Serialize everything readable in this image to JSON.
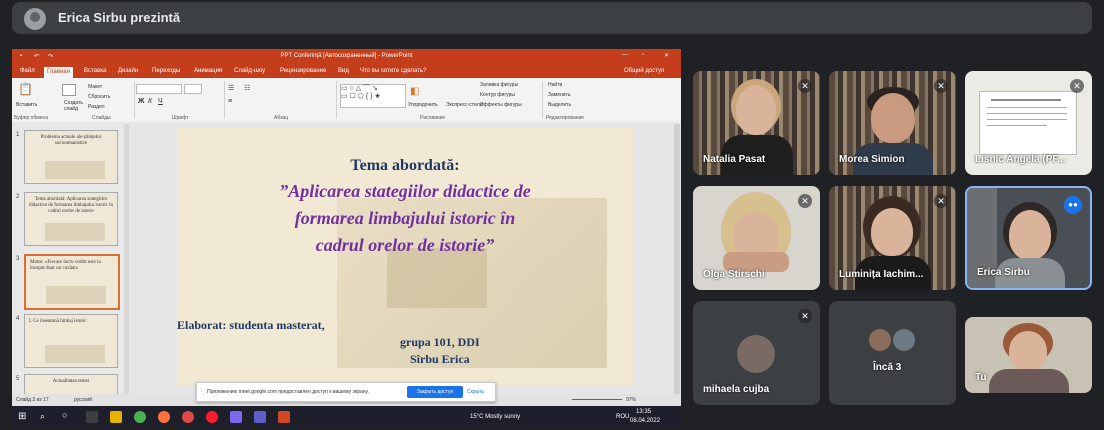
{
  "presenter": {
    "text": "Erica Sirbu prezintă"
  },
  "ppt": {
    "title": "PPT Conferinţă [Автосохраненный] - PowerPoint",
    "tabs": [
      "Файл",
      "Главная",
      "Вставка",
      "Дизайн",
      "Переходы",
      "Анимация",
      "Слайд-шоу",
      "Рецензирование",
      "Вид",
      "Что вы хотите сделать?"
    ],
    "share": "Общий доступ",
    "ribbon": {
      "paste": "Вставить",
      "new_slide": "Создать слайд",
      "layout": "Макет",
      "reset": "Сбросить",
      "section": "Раздел",
      "groups": [
        "Буфер обмена",
        "Слайды",
        "Шрифт",
        "Абзац",
        "Рисование",
        "Редактирование"
      ],
      "arrange": "Упорядочить",
      "quick_styles": "Экспресс-стили",
      "fill": "Заливка фигуры",
      "outline": "Контур фигуры",
      "effects": "Эффекты фигуры",
      "find": "Найти",
      "replace": "Заменить",
      "select": "Выделить"
    },
    "thumbs": [
      {
        "num": "1",
        "text": "Problema actuale ale științelor socioumanistice"
      },
      {
        "num": "2",
        "text": "Tema abordată: Aplicarea stategiilor didactice de formarea limbajului istoric în cadrul orelor de istorie"
      },
      {
        "num": "3",
        "text": "Motto: «Fiecare lucru vorbit este la început doar un cuvânt»"
      },
      {
        "num": "4",
        "text": "I. Ce înseamnă limbaj istoric"
      },
      {
        "num": "5",
        "text": "Actualitatea temei"
      }
    ],
    "slide": {
      "title": "Tema abordată:",
      "line1": "”Aplicarea stategiilor didactice de",
      "line2": "formarea limbajului istoric în",
      "line3": "cadrul orelor de istorie”",
      "author1": "Elaborat: studenta masterat,",
      "author2": "grupa 101, DDI",
      "author3": "Sîrbu Erica"
    },
    "status": {
      "slide": "Слайд 3 из 17",
      "lang": "русский",
      "zoom": "97%"
    },
    "taskbar": {
      "weather": "15°C  Mostly sunny",
      "lang": "ROU",
      "time": "13:35",
      "date": "08.04.2022"
    }
  },
  "notice": {
    "text": "Приложению meet.google.com предоставлен доступ к вашему экрану.",
    "stop": "Закрыть доступ",
    "hide": "Скрыть"
  },
  "participants": [
    {
      "name": "Natalia Pasat",
      "muted": true
    },
    {
      "name": "Morea Simion",
      "muted": true
    },
    {
      "name": "Lisnic Angela (PF...",
      "muted": true
    },
    {
      "name": "Olga Stirschi",
      "muted": true
    },
    {
      "name": "Luminița Iachim...",
      "muted": true
    },
    {
      "name": "Erica Sirbu",
      "speaking": true
    },
    {
      "name": "mihaela cujba",
      "muted": true
    },
    {
      "name": "Încă 3"
    },
    {
      "name": "Tu"
    }
  ],
  "colors": {
    "ppt_accent": "#c43e1c",
    "meet_bg": "#202124",
    "tile_bg": "#3c4043",
    "speaking": "#1a73e8",
    "slide_purple": "#7030a0",
    "slide_navy": "#1f3864"
  }
}
